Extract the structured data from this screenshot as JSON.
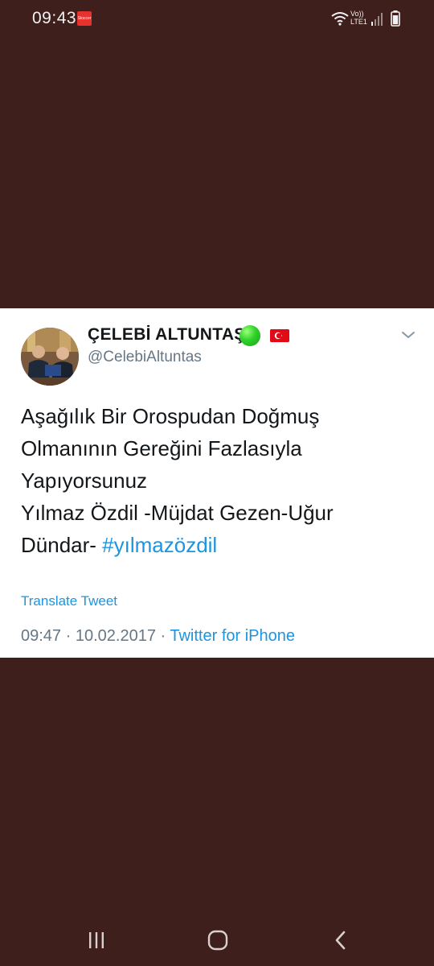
{
  "status_bar": {
    "time": "09:43",
    "notification_label": "Stoccer",
    "network_top": "Vo))",
    "network_bottom": "LTE1"
  },
  "tweet": {
    "display_name": "ÇELEBİ ALTUNTAŞ",
    "handle": "@CelebiAltuntas",
    "text_lines": [
      "Aşağılık Bir Orospudan Doğmuş",
      "Olmanının Gereğini Fazlasıyla",
      "Yapıyorsunuz",
      "Yılmaz Özdil -Müjdat Gezen-Uğur"
    ],
    "last_line_prefix": "Dündar- ",
    "hashtag": "#yılmazözdil",
    "translate_label": "Translate Tweet",
    "time": "09:47",
    "separator": " · ",
    "date": "10.02.2017",
    "source": "Twitter for iPhone"
  },
  "colors": {
    "background": "#3f1f1c",
    "link": "#1b95e0",
    "secondary_text": "#657786",
    "flag_red": "#e30a17",
    "verified_green": "#2fd12a"
  },
  "icons": {
    "menu": "chevron-down-icon",
    "recents": "recent-apps-icon",
    "home": "home-icon",
    "back": "back-icon"
  }
}
